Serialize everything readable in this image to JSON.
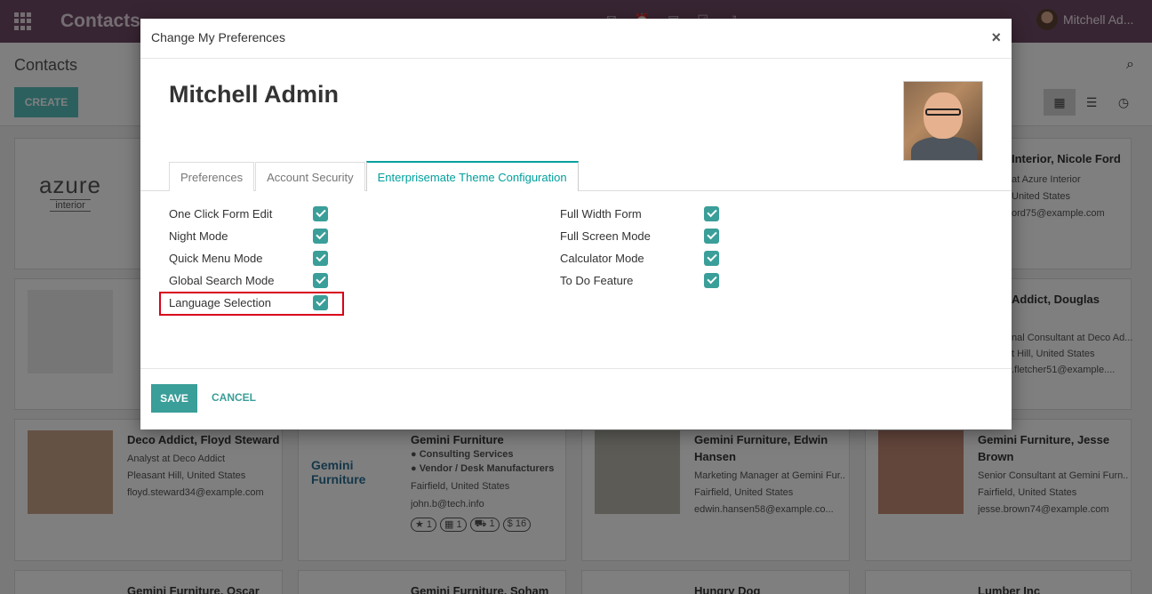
{
  "topbar": {
    "brand": "Contacts",
    "badges": {
      "chat": "9",
      "activity": "5"
    },
    "user_name": "Mitchell Ad..."
  },
  "control_panel": {
    "title": "Contacts",
    "create_label": "CREATE"
  },
  "cards": [
    {
      "title": "Deco Addict, Floyd Steward",
      "lines": [
        "Analyst at Deco Addict",
        "Pleasant Hill, United States",
        "floyd.steward34@example.com"
      ]
    },
    {
      "title": "Gemini Furniture",
      "lines": [
        "Consulting Services",
        "Vendor / Desk Manufacturers",
        "Fairfield, United States",
        "john.b@tech.info"
      ],
      "counters": [
        "1",
        "1",
        "1",
        "$ 16"
      ]
    },
    {
      "title": "Gemini Furniture, Edwin Hansen",
      "lines": [
        "Marketing Manager at Gemini Fur...",
        "Fairfield, United States",
        "edwin.hansen58@example.co..."
      ]
    },
    {
      "title": "Gemini Furniture, Jesse Brown",
      "lines": [
        "Senior Consultant at Gemini Furn...",
        "Fairfield, United States",
        "jesse.brown74@example.com"
      ]
    },
    {
      "title": "Interior, Nicole Ford",
      "lines": [
        "at Azure Interior",
        "United States",
        "ord75@example.com"
      ]
    },
    {
      "title": "Addict, Douglas",
      "lines": [
        "nal Consultant at Deco Ad...",
        "t Hill, United States",
        ".fletcher51@example...."
      ]
    },
    {
      "title": "Gemini Furniture, Oscar",
      "lines": []
    },
    {
      "title": "Gemini Furniture, Soham",
      "lines": []
    },
    {
      "title": "Hungry Dog",
      "lines": []
    },
    {
      "title": "Lumber Inc",
      "lines": []
    }
  ],
  "azure_logo": {
    "main": "azure",
    "sub": "interior"
  },
  "modal": {
    "title": "Change My Preferences",
    "close": "×",
    "user_name": "Mitchell Admin",
    "tabs": [
      "Preferences",
      "Account Security",
      "Enterprisemate Theme Configuration"
    ],
    "left_options": [
      {
        "label": "One Click Form Edit",
        "checked": true
      },
      {
        "label": "Night Mode",
        "checked": true
      },
      {
        "label": "Quick Menu Mode",
        "checked": true
      },
      {
        "label": "Global Search Mode",
        "checked": true
      },
      {
        "label": "Language Selection",
        "checked": true
      }
    ],
    "right_options": [
      {
        "label": "Full Width Form",
        "checked": true
      },
      {
        "label": "Full Screen Mode",
        "checked": true
      },
      {
        "label": "Calculator Mode",
        "checked": true
      },
      {
        "label": "To Do Feature",
        "checked": true
      }
    ],
    "save_label": "SAVE",
    "cancel_label": "CANCEL"
  },
  "colors": {
    "topbar": "#714b67",
    "accent": "#3a9e99",
    "highlight": "#d9001b"
  }
}
